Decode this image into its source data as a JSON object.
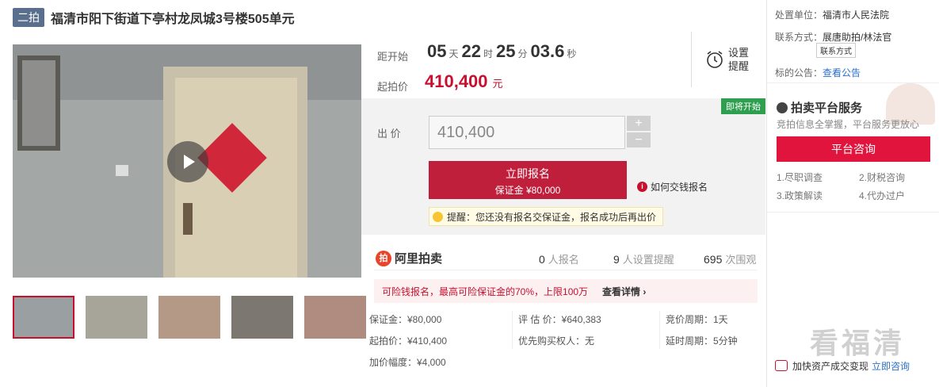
{
  "header": {
    "tag": "二拍",
    "title": "福清市阳下街道下亭村龙凤城3号楼505单元"
  },
  "countdown": {
    "label": "距开始",
    "days": "05",
    "days_unit": "天",
    "hours": "22",
    "hours_unit": "时",
    "minutes": "25",
    "minutes_unit": "分",
    "seconds": "03.6",
    "seconds_unit": "秒"
  },
  "start": {
    "label": "起拍价",
    "price": "410,400",
    "unit": "元"
  },
  "remind": {
    "label": "设置提醒",
    "icon": "alarm-clock-icon"
  },
  "bid": {
    "status_badge": "即将开始",
    "label": "出 价",
    "input_value": "410,400",
    "plus": "+",
    "minus": "−",
    "signup_main": "立即报名",
    "signup_sub": "保证金 ¥80,000",
    "howto": "如何交钱报名",
    "tip": "提醒：您还没有报名交保证金，报名成功后再出价"
  },
  "stats": {
    "brand": "阿里拍卖",
    "signups": "0",
    "signups_label": "人报名",
    "reminders": "9",
    "reminders_label": "人设置提醒",
    "views": "695",
    "views_label": "次围观"
  },
  "promo": {
    "text": "可险钱报名，最高可险保证金的70%，上限100万",
    "link": "查看详情 ›"
  },
  "facts": {
    "deposit": "保证金：¥80,000",
    "appraisal": "评 估 价：¥640,383",
    "cycle": "竞价周期：1天",
    "start_price": "起拍价：¥410,400",
    "priority": "优先购买权人",
    "priority_value": "：无",
    "delay": "延时周期：5分钟",
    "increment": "加价幅度：¥4,000"
  },
  "right": {
    "org_label": "处置单位：",
    "org": "福清市人民法院",
    "contact_label": "联系方式：",
    "contact": "展唐助拍/林法官",
    "contact_btn": "联系方式",
    "notice_label": "标的公告：",
    "notice_link": "查看公告",
    "service_title": "拍卖平台服务",
    "service_sub": "竞拍信息全掌握，平台服务更放心",
    "consult_btn": "平台咨询",
    "items": [
      "1.尽职调查",
      "2.财税咨询",
      "3.政策解读",
      "4.代办过户"
    ],
    "bottom_text": "加快资产成交变现",
    "bottom_link": "立即咨询"
  },
  "watermark": "看福清"
}
